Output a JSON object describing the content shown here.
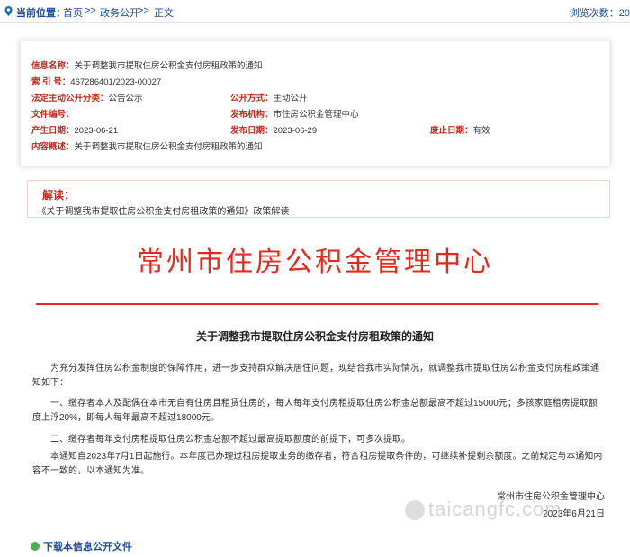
{
  "topbar": {
    "location_label": "当前位置：",
    "crumbs": [
      "首页",
      ">>",
      "政务公开",
      ">>",
      "正文"
    ],
    "views_label": "浏览次数：20"
  },
  "meta": {
    "name_key": "信息名称：",
    "name_val": "关于调整我市提取住房公积金支付房租政策的通知",
    "index_key": "索  引  号：",
    "index_val": "467286401/2023-00027",
    "category_key": "法定主动公开分类：",
    "category_val": "公告公示",
    "method_key": "公开方式：",
    "method_val": "主动公开",
    "docno_key": "文件编号：",
    "docno_val": "",
    "publisher_key": "发布机构：",
    "publisher_val": "市住房公积金管理中心",
    "created_key": "产生日期：",
    "created_val": "2023-06-21",
    "published_key": "发布日期：",
    "published_val": "2023-06-29",
    "expire_key": "废止日期：",
    "expire_val": "有效",
    "summary_key": "内容概述：",
    "summary_val": "关于调整我市提取住房公积金支付房租政策的通知"
  },
  "jiedu": {
    "title": "解读：",
    "link": "·《关于调整我市提取住房公积金支付房租政策的通知》政策解读"
  },
  "doc": {
    "org_title": "常州市住房公积金管理中心",
    "title": "关于调整我市提取住房公积金支付房租政策的通知",
    "p1": "为充分发挥住房公积金制度的保障作用，进一步支持群众解决居住问题，现结合我市实际情况，就调整我市提取住房公积金支付房租政策通知如下：",
    "p2": "一、缴存者本人及配偶在本市无自有住房且租赁住房的，每人每年支付房租提取住房公积金总额最高不超过15000元；多孩家庭租房提取额度上浮20%，即每人每年最高不超过18000元。",
    "p3": "二、缴存者每年支付房租提取住房公积金总额不超过最高提取额度的前提下，可多次提取。",
    "p4": "本通知自2023年7月1日起施行。本年度已办理过租房提取业务的缴存者，符合租房提取条件的，可继续补提剩余额度。之前规定与本通知内容不一致的，以本通知为准。",
    "sign_org": "常州市住房公积金管理中心",
    "sign_date": "2023年6月21日"
  },
  "watermark": "taicangfc.com",
  "download_label": "下载本信息公开文件"
}
